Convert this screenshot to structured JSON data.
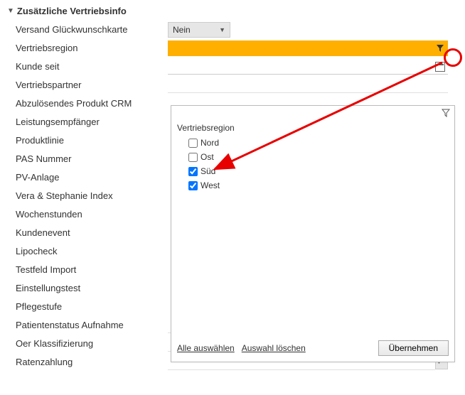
{
  "section": {
    "title": "Zusätzliche Vertriebsinfo"
  },
  "rows": {
    "versand": {
      "label": "Versand Glückwunschkarte",
      "value": "Nein"
    },
    "vertriebsregion": {
      "label": "Vertriebsregion"
    },
    "kundeseit": {
      "label": "Kunde seit"
    },
    "vertriebspartner": {
      "label": "Vertriebspartner"
    },
    "abzul": {
      "label": "Abzulösendes Produkt CRM"
    },
    "leistungsempf": {
      "label": "Leistungsempfänger"
    },
    "produktlinie": {
      "label": "Produktlinie"
    },
    "pas": {
      "label": "PAS Nummer"
    },
    "pv": {
      "label": "PV-Anlage"
    },
    "vera": {
      "label": "Vera & Stephanie Index"
    },
    "wochen": {
      "label": "Wochenstunden"
    },
    "kundenevent": {
      "label": "Kundenevent"
    },
    "lipocheck": {
      "label": "Lipocheck"
    },
    "testfeld": {
      "label": "Testfeld Import"
    },
    "einstell": {
      "label": "Einstellungstest"
    },
    "pflegestufe": {
      "label": "Pflegestufe"
    },
    "patientenstatus": {
      "label": "Patientenstatus Aufnahme"
    },
    "oer": {
      "label": "Oer Klassifizierung"
    },
    "ratenzahlung": {
      "label": "Ratenzahlung"
    }
  },
  "filter": {
    "title": "Vertriebsregion",
    "options": [
      {
        "label": "Nord",
        "checked": false
      },
      {
        "label": "Ost",
        "checked": false
      },
      {
        "label": "Süd",
        "checked": true
      },
      {
        "label": "West",
        "checked": true
      }
    ],
    "selectAll": "Alle auswählen",
    "clear": "Auswahl löschen",
    "apply": "Übernehmen"
  }
}
